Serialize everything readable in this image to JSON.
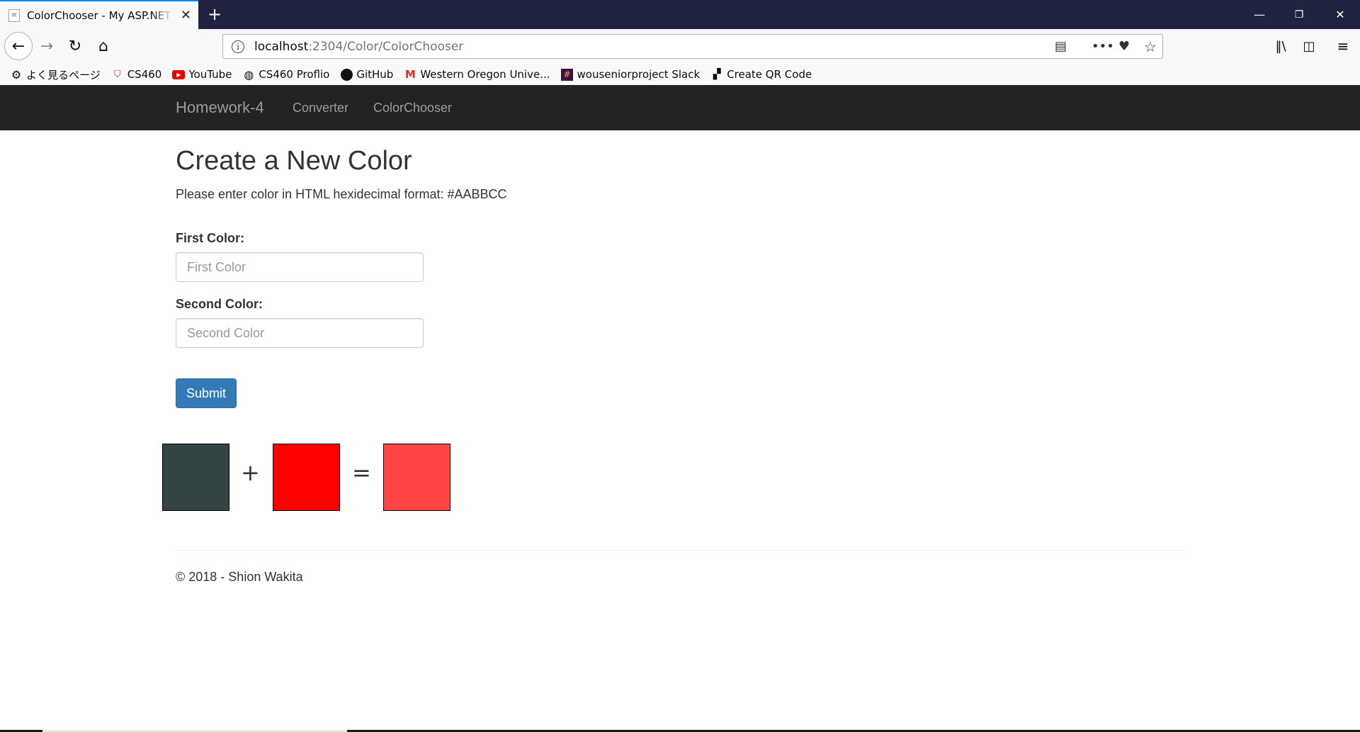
{
  "browser": {
    "tab_title": "ColorChooser - My ASP.NET Application",
    "new_tab_symbol": "+",
    "window_controls": [
      "—",
      "❐",
      "✕"
    ],
    "url_host": "localhost",
    "url_path": ":2304/Color/ColorChooser",
    "bookmarks": [
      {
        "label": "よく見るページ",
        "icon": "gear-icon"
      },
      {
        "label": "CS460",
        "icon": "shield-icon"
      },
      {
        "label": "YouTube",
        "icon": "youtube-icon"
      },
      {
        "label": "CS460 Proflio",
        "icon": "globe-icon"
      },
      {
        "label": "GitHub",
        "icon": "github-icon"
      },
      {
        "label": "Western Oregon Unive...",
        "icon": "gmail-icon"
      },
      {
        "label": "wouseniorproject Slack",
        "icon": "slack-icon"
      },
      {
        "label": "Create QR Code",
        "icon": "qr-icon"
      }
    ]
  },
  "site": {
    "brand": "Homework-4",
    "nav_links": [
      "Converter",
      "ColorChooser"
    ]
  },
  "page": {
    "heading": "Create a New Color",
    "instructions": "Please enter color in HTML hexidecimal format: #AABBCC",
    "first_label": "First Color:",
    "first_placeholder": "First Color",
    "second_label": "Second Color:",
    "second_placeholder": "Second Color",
    "submit_label": "Submit",
    "plus": "+",
    "equals": "="
  },
  "colors": {
    "first": "#344444",
    "second": "#ff0000",
    "result": "#ff4444",
    "navbar_bg": "#222222",
    "button_bg": "#337ab7"
  },
  "footer": {
    "text": "© 2018 - Shion Wakita"
  }
}
